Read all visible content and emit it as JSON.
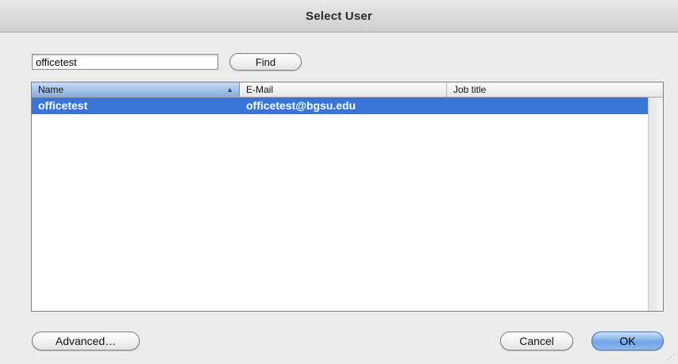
{
  "window": {
    "title": "Select User"
  },
  "search": {
    "value": "officetest",
    "find_label": "Find"
  },
  "table": {
    "columns": [
      {
        "label": "Name",
        "sorted": "ascending"
      },
      {
        "label": "E-Mail"
      },
      {
        "label": "Job title"
      }
    ],
    "rows": [
      {
        "name": "officetest",
        "email": "officetest@bgsu.edu",
        "job_title": "",
        "selected": true
      }
    ]
  },
  "buttons": {
    "advanced_label": "Advanced…",
    "cancel_label": "Cancel",
    "ok_label": "OK"
  },
  "icons": {
    "sort": "sort-ascending-icon",
    "grip": "resize-grip-icon"
  },
  "colors": {
    "selection": "#3875d7",
    "default_button": "#6fa5e5"
  }
}
